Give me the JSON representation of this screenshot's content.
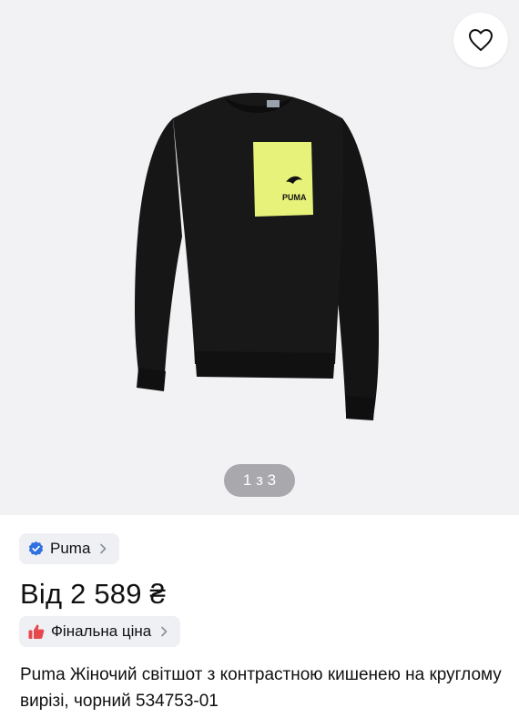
{
  "gallery": {
    "counter": "1 з 3",
    "image_alt": "product-photo-black-sweatshirt",
    "pocket_logo_text": "PUMA"
  },
  "favorite": {
    "icon": "heart-icon"
  },
  "product": {
    "brand": "Puma",
    "brand_icon": "verified-badge-icon",
    "price": "Від 2 589 ₴",
    "final_price_label": "Фінальна ціна",
    "final_price_icon": "thumbs-up-icon",
    "title": "Puma Жіночий світшот з контрастною кишенею на круглому вирізі, чорний 534753-01"
  },
  "colors": {
    "verified_blue": "#2f6fdf",
    "thumb_red": "#e5484d",
    "pocket_yellow": "#e6f27a",
    "garment_black": "#151515"
  }
}
